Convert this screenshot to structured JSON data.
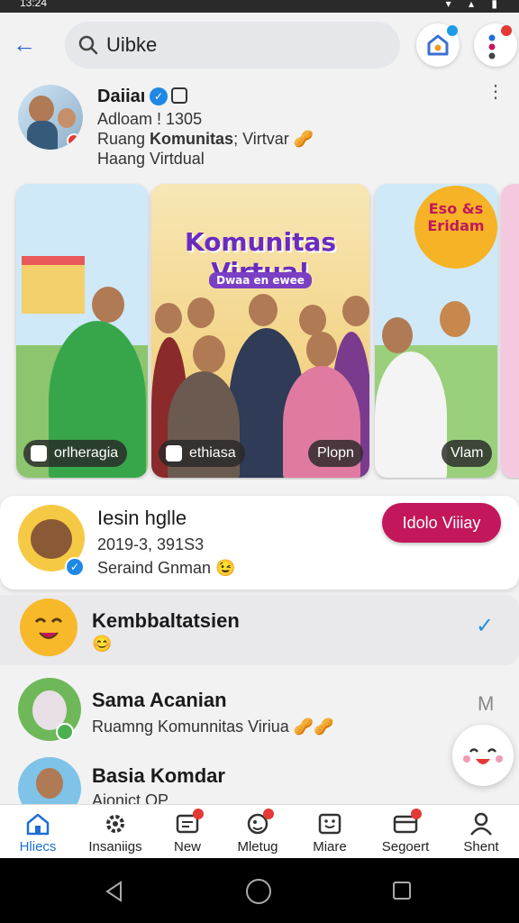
{
  "status": {
    "time": "13:24",
    "icons": "▾ ▴ ▮"
  },
  "topbar": {
    "back_glyph": "←",
    "search_query": "Uibke",
    "colors": {
      "accent": "#2a66c8",
      "badge_blue": "#1e9be8",
      "badge_red": "#e53935"
    }
  },
  "profile": {
    "name": "Daiiaı",
    "line1": "Adloam ! 1305",
    "line2_prefix": "Ruang ",
    "line2_bold": "Komunitas",
    "line2_suffix": "; Virtvar 🥜",
    "line3": "Haang Virtdual",
    "more_glyph": "⋮"
  },
  "stories": [
    {
      "caption": "orlheragia",
      "colors": [
        "#bfe3f7",
        "#7dc06a"
      ]
    },
    {
      "caption": "ethiasa",
      "banner": "Komunitas Virtua!",
      "sub": "Dwaa en ewee",
      "colors": [
        "#f4e4b0",
        "#f6c23a"
      ]
    },
    {
      "caption": "Plopn",
      "colors": [
        "#f4e4b0",
        "#f6c23a"
      ]
    },
    {
      "caption": "Vlam",
      "banner": "Eso &s Eridam",
      "colors": [
        "#bfe3f7",
        "#9ad07c"
      ]
    }
  ],
  "featured": {
    "title": "Iesin hglle",
    "line1": "2019-3, 391S3",
    "line2": "Seraind Gnman 😉",
    "button": "Idolo Viiiay",
    "button_color": "#c2185b"
  },
  "list": [
    {
      "title": "Kembbaltatsien",
      "sub": "😊",
      "trailing": "✓"
    },
    {
      "title": "Sama Acanian",
      "sub": "Ruamng Komunnitas Viriua 🥜🥜",
      "trailing": "M"
    },
    {
      "title": "Basia Komdar",
      "sub": "Aionict OP",
      "trailing": ""
    }
  ],
  "bottom_nav": [
    {
      "label": "Hliecs",
      "icon": "home-icon",
      "badge": false,
      "active": true
    },
    {
      "label": "Insaniigs",
      "icon": "gear-icon",
      "badge": false,
      "active": false
    },
    {
      "label": "New",
      "icon": "news-icon",
      "badge": true,
      "active": false
    },
    {
      "label": "Mletug",
      "icon": "meeting-icon",
      "badge": true,
      "active": false
    },
    {
      "label": "Miare",
      "icon": "frame-icon",
      "badge": false,
      "active": false
    },
    {
      "label": "Segoert",
      "icon": "card-icon",
      "badge": true,
      "active": false
    },
    {
      "label": "Shent",
      "icon": "person-icon",
      "badge": false,
      "active": false
    }
  ]
}
